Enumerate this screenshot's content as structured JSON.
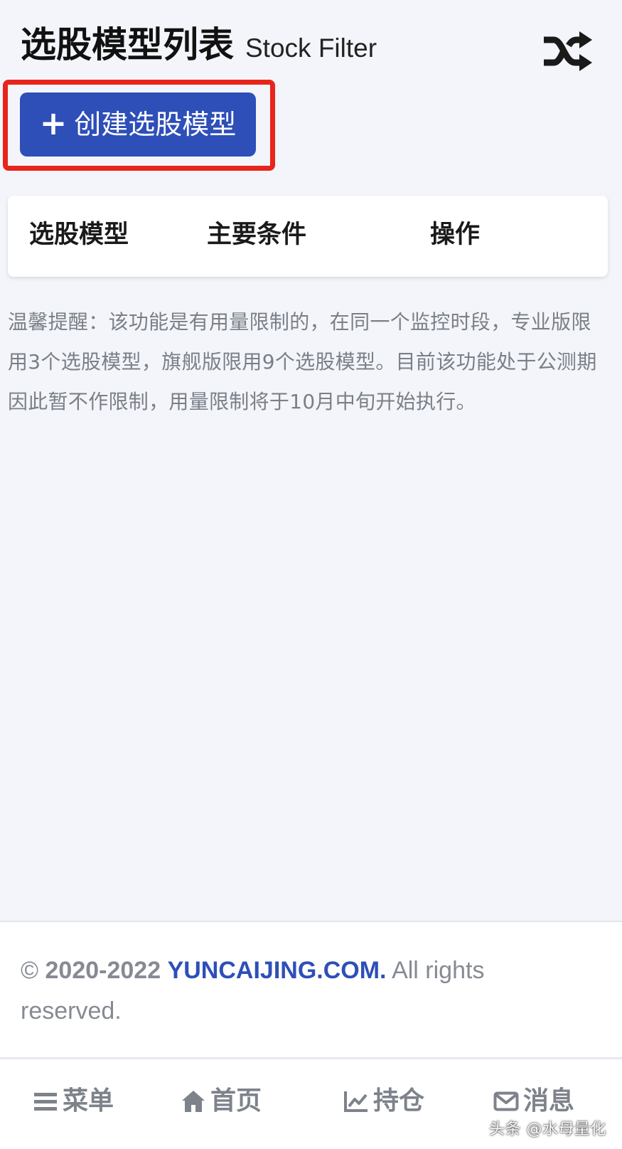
{
  "header": {
    "title": "选股模型列表",
    "subtitle": "Stock Filter",
    "shuffle_icon": "shuffle-icon"
  },
  "create_button": {
    "plus": "+",
    "label": "创建选股模型",
    "color": "#2e4fb8"
  },
  "highlight": {
    "color": "#e8241b"
  },
  "table": {
    "columns": [
      "选股模型",
      "主要条件",
      "操作"
    ]
  },
  "notice": {
    "text": "温馨提醒：该功能是有用量限制的，在同一个监控时段，专业版限用3个选股模型，旗舰版限用9个选股模型。目前该功能处于公测期因此暂不作限制，用量限制将于10月中旬开始执行。"
  },
  "footer": {
    "copyright_symbol": "©",
    "years": "2020-2022",
    "brand": "YUNCAIJING.COM.",
    "rights": "All rights reserved."
  },
  "bottom_nav": {
    "items": [
      {
        "label": "菜单",
        "icon": "menu-icon"
      },
      {
        "label": "首页",
        "icon": "home-icon"
      },
      {
        "label": "持仓",
        "icon": "chart-line-icon"
      },
      {
        "label": "消息",
        "icon": "envelope-icon"
      }
    ]
  },
  "watermark": {
    "text": "头条 @水母量化"
  }
}
